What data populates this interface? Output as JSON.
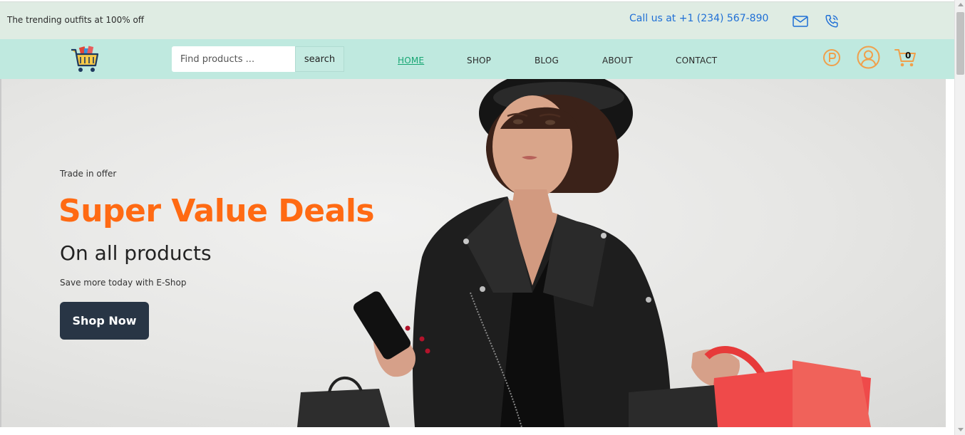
{
  "topbar": {
    "promo": "The trending outfits at 100% off",
    "call": "Call us at +1 (234) 567-890",
    "icons": {
      "mail": "mail-icon",
      "phone": "phone-icon"
    }
  },
  "nav": {
    "logo_icon": "shopping-cart-logo-icon",
    "search": {
      "placeholder": "Find products ...",
      "value": "",
      "button": "search"
    },
    "links": [
      "HOME",
      "SHOP",
      "BLOG",
      "ABOUT",
      "CONTACT"
    ],
    "active_link": "HOME",
    "icons": {
      "points": "p-badge-icon",
      "account": "user-icon",
      "cart": "cart-icon"
    },
    "cart_count": "0"
  },
  "hero": {
    "eyebrow": "Trade in offer",
    "headline": "Super Value Deals",
    "subheadline": "On all products",
    "tagline": "Save more today with E-Shop",
    "cta": "Shop Now"
  },
  "colors": {
    "topbar_bg": "#dfece3",
    "navbar_bg": "#bfe9df",
    "accent_orange": "#ff6a13",
    "link_active": "#17a673",
    "call_blue": "#1f6fd6",
    "button_dark": "#283545",
    "icon_orange": "#f0a04b"
  }
}
